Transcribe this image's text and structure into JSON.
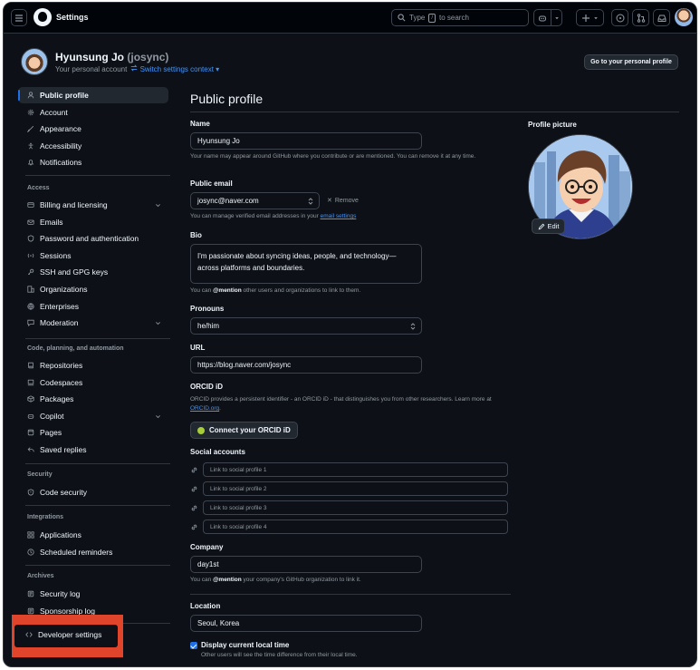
{
  "header": {
    "app_title": "Settings",
    "search_prefix": "Type",
    "search_key": "/",
    "search_suffix": "to search"
  },
  "context": {
    "display_name": "Hyunsung Jo",
    "login": "(josync)",
    "subtitle": "Your personal account",
    "switch_label": "Switch settings context",
    "profile_button": "Go to your personal profile"
  },
  "sidebar": {
    "items": [
      {
        "label": "Public profile",
        "icon": "person-icon"
      },
      {
        "label": "Account",
        "icon": "gear-icon"
      },
      {
        "label": "Appearance",
        "icon": "paintbrush-icon"
      },
      {
        "label": "Accessibility",
        "icon": "accessibility-icon"
      },
      {
        "label": "Notifications",
        "icon": "bell-icon"
      }
    ],
    "access_heading": "Access",
    "access_items": [
      {
        "label": "Billing and licensing",
        "icon": "credit-card-icon"
      },
      {
        "label": "Emails",
        "icon": "mail-icon"
      },
      {
        "label": "Password and authentication",
        "icon": "shield-lock-icon"
      },
      {
        "label": "Sessions",
        "icon": "broadcast-icon"
      },
      {
        "label": "SSH and GPG keys",
        "icon": "key-icon"
      },
      {
        "label": "Organizations",
        "icon": "organization-icon"
      },
      {
        "label": "Enterprises",
        "icon": "globe-icon"
      },
      {
        "label": "Moderation",
        "icon": "report-icon"
      }
    ],
    "code_heading": "Code, planning, and automation",
    "code_items": [
      {
        "label": "Repositories",
        "icon": "repo-icon"
      },
      {
        "label": "Codespaces",
        "icon": "codespaces-icon"
      },
      {
        "label": "Packages",
        "icon": "package-icon"
      },
      {
        "label": "Copilot",
        "icon": "copilot-icon"
      },
      {
        "label": "Pages",
        "icon": "browser-icon"
      },
      {
        "label": "Saved replies",
        "icon": "reply-icon"
      }
    ],
    "security_heading": "Security",
    "security_items": [
      {
        "label": "Code security",
        "icon": "shield-icon"
      }
    ],
    "integrations_heading": "Integrations",
    "integrations_items": [
      {
        "label": "Applications",
        "icon": "apps-icon"
      },
      {
        "label": "Scheduled reminders",
        "icon": "clock-icon"
      }
    ],
    "archives_heading": "Archives",
    "archives_items": [
      {
        "label": "Security log",
        "icon": "log-icon"
      },
      {
        "label": "Sponsorship log",
        "icon": "log-icon"
      }
    ],
    "developer_settings": "Developer settings"
  },
  "main": {
    "title": "Public profile",
    "name_label": "Name",
    "name_value": "Hyunsung Jo",
    "name_note": "Your name may appear around GitHub where you contribute or are mentioned. You can remove it at any time.",
    "email_label": "Public email",
    "email_value": "josync@naver.com",
    "remove_label": "Remove",
    "email_note_prefix": "You can manage verified email addresses in your",
    "email_note_link": "email settings",
    "bio_label": "Bio",
    "bio_value": "I'm passionate about syncing ideas, people, and technology—across platforms and boundaries.",
    "bio_note_prefix": "You can",
    "bio_note_mention": "@mention",
    "bio_note_suffix": "other users and organizations to link to them.",
    "pronouns_label": "Pronouns",
    "pronouns_value": "he/him",
    "url_label": "URL",
    "url_value": "https://blog.naver.com/josync",
    "orcid_label": "ORCID iD",
    "orcid_note_1": "ORCID provides a persistent identifier - an ORCID iD - that distinguishes you from other researchers. Learn",
    "orcid_note_2_prefix": "more at",
    "orcid_note_link": "ORCID.org",
    "orcid_button": "Connect your ORCID iD",
    "social_label": "Social accounts",
    "social_placeholders": [
      "Link to social profile 1",
      "Link to social profile 2",
      "Link to social profile 3",
      "Link to social profile 4"
    ],
    "company_label": "Company",
    "company_value": "day1st",
    "company_note_prefix": "You can",
    "company_note_mention": "@mention",
    "company_note_suffix": "your company's GitHub organization to link it.",
    "location_label": "Location",
    "location_value": "Seoul, Korea",
    "local_time_label": "Display current local time",
    "local_time_note": "Other users will see the time difference from their local time.",
    "local_time_checked": true
  },
  "profile_picture": {
    "label": "Profile picture",
    "edit_label": "Edit"
  },
  "colors": {
    "background": "#0d1117",
    "accent": "#1f6feb",
    "link": "#4493f8",
    "highlight": "#e0452c"
  }
}
